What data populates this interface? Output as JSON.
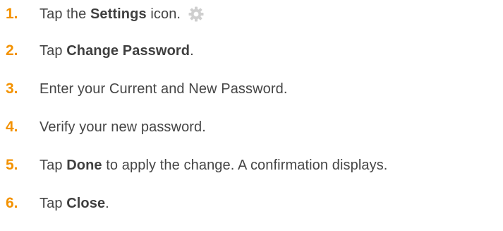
{
  "steps": [
    {
      "number": "1.",
      "parts": [
        "Tap the ",
        "Settings",
        " icon."
      ],
      "icon": "gear-icon"
    },
    {
      "number": "2.",
      "parts": [
        "Tap ",
        "Change Password",
        "."
      ]
    },
    {
      "number": "3.",
      "parts": [
        "Enter your Current and New Password."
      ]
    },
    {
      "number": "4.",
      "parts": [
        "Verify your new password."
      ]
    },
    {
      "number": "5.",
      "parts": [
        "Tap ",
        "Done",
        " to apply the change. A confirmation displays."
      ]
    },
    {
      "number": "6.",
      "parts": [
        "Tap ",
        "Close",
        "."
      ]
    }
  ],
  "colors": {
    "step_number": "#f39200",
    "text": "#454545",
    "icon": "#cccccc"
  }
}
